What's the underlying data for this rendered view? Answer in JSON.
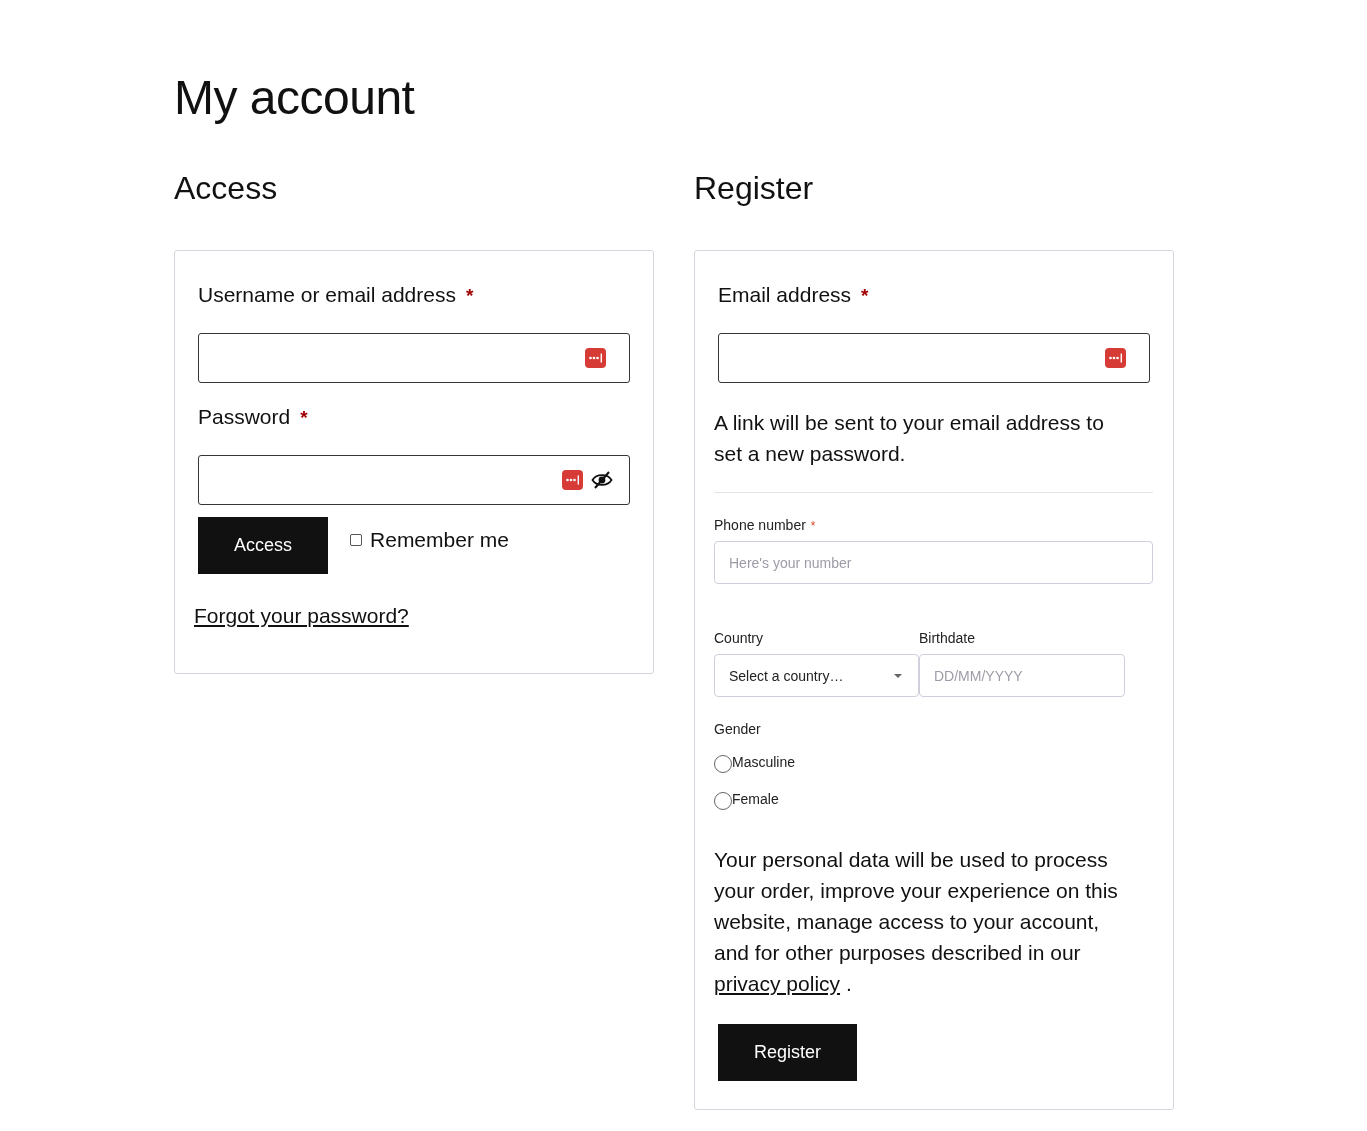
{
  "page": {
    "title": "My account"
  },
  "login": {
    "heading": "Access",
    "fields": [
      {
        "kind": "text",
        "label": "Username or email address",
        "required_mark": "*"
      },
      {
        "kind": "password",
        "label": "Password",
        "required_mark": "*"
      }
    ],
    "submit": "Access",
    "remember": {
      "label": "Remember me",
      "checked": false
    },
    "forgot_link": "Forgot your password?"
  },
  "register": {
    "heading": "Register",
    "email": {
      "kind": "email",
      "label": "Email address",
      "required_mark": "*"
    },
    "note": "A link will be sent to your email address to set a new password.",
    "phone": {
      "label": "Phone number",
      "required_mark": "*",
      "placeholder": "Here's your number"
    },
    "country": {
      "label": "Country",
      "value": "Select a country…"
    },
    "birthdate": {
      "label": "Birthdate",
      "placeholder": "DD/MM/YYYY"
    },
    "gender": {
      "label": "Gender",
      "options": [
        {
          "label": "Masculine",
          "selected": false
        },
        {
          "label": "Female",
          "selected": false
        }
      ]
    },
    "privacy": {
      "text": "Your personal data will be used to process your order, improve your experience on this website, manage access to your account, and for other purposes described in our",
      "link": "privacy policy",
      "after": "."
    },
    "submit": "Register"
  }
}
